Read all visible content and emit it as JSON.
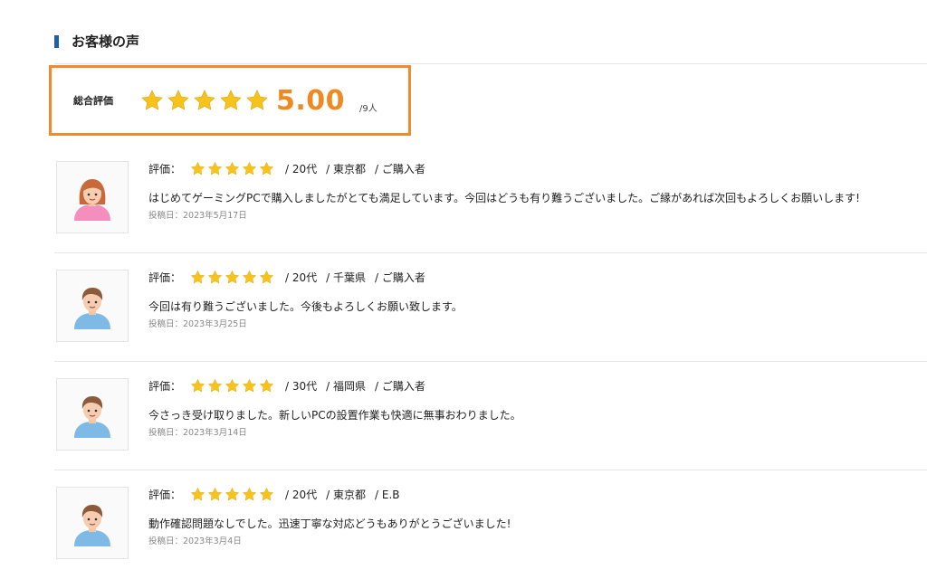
{
  "section": {
    "title": "お客様の声"
  },
  "summary": {
    "label": "総合評価",
    "score": "5.00",
    "count": "/9人",
    "stars": 5
  },
  "colors": {
    "accent": "#f08a2c",
    "star": "#f6c21c",
    "title_bar": "#1f5fa8"
  },
  "reviews": [
    {
      "rating_label": "評価：",
      "stars": 5,
      "age": "/ 20代",
      "location": "/ 東京都",
      "purchase": "/ ご購入者",
      "comment": "はじめてゲーミングPCで購入しましたがとても満足しています。今回はどうも有り難うございました。ご縁があれば次回もよろしくお願いします!",
      "posted": "投稿日：2023年5月17日",
      "avatar": "female-avatar-icon"
    },
    {
      "rating_label": "評価：",
      "stars": 5,
      "age": "/ 20代",
      "location": "/ 千葉県",
      "purchase": "/ ご購入者",
      "comment": "今回は有り難うございました。今後もよろしくお願い致します。",
      "posted": "投稿日：2023年3月25日",
      "avatar": "male-avatar-icon"
    },
    {
      "rating_label": "評価：",
      "stars": 5,
      "age": "/ 30代",
      "location": "/ 福岡県",
      "purchase": "/ ご購入者",
      "comment": "今さっき受け取りました。新しいPCの設置作業も快適に無事おわりました。",
      "posted": "投稿日：2023年3月14日",
      "avatar": "male-avatar-icon"
    },
    {
      "rating_label": "評価：",
      "stars": 5,
      "age": "/ 20代",
      "location": "/ 東京都",
      "purchase": "/ E.B",
      "comment": "動作確認問題なしでした。迅速丁寧な対応どうもありがとうございました!",
      "posted": "投稿日：2023年3月4日",
      "avatar": "male-avatar-icon"
    }
  ]
}
